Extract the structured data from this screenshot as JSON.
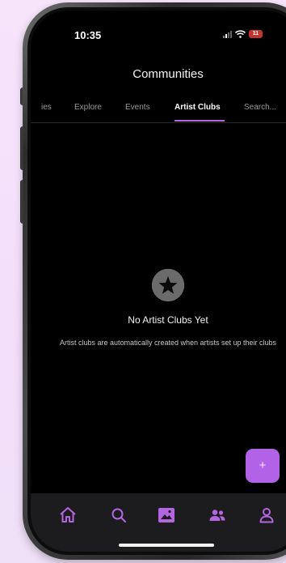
{
  "status_bar": {
    "time": "10:35",
    "battery": "11",
    "icons": [
      "cellular-signal-icon",
      "wifi-icon",
      "battery-icon"
    ]
  },
  "header": {
    "title": "Communities"
  },
  "tabs": [
    {
      "label": "ies",
      "active": false
    },
    {
      "label": "Explore",
      "active": false
    },
    {
      "label": "Events",
      "active": false
    },
    {
      "label": "Artist Clubs",
      "active": true
    },
    {
      "label": "Search...",
      "active": false
    }
  ],
  "empty_state": {
    "icon": "star-icon",
    "title": "No Artist Clubs Yet",
    "description": "Artist clubs are automatically created when artists set up their clubs"
  },
  "fab": {
    "icon": "plus-icon",
    "label": "+"
  },
  "bottom_nav": [
    {
      "icon": "home-icon",
      "active": false
    },
    {
      "icon": "search-icon",
      "active": false
    },
    {
      "icon": "gallery-icon",
      "active": true
    },
    {
      "icon": "people-icon",
      "active": false
    },
    {
      "icon": "profile-icon",
      "active": false
    }
  ],
  "colors": {
    "accent": "#b466e0",
    "background": "#000000",
    "nav_background": "#1c1c1e",
    "page_background": "#f6e4fb",
    "battery": "#c4342f"
  }
}
